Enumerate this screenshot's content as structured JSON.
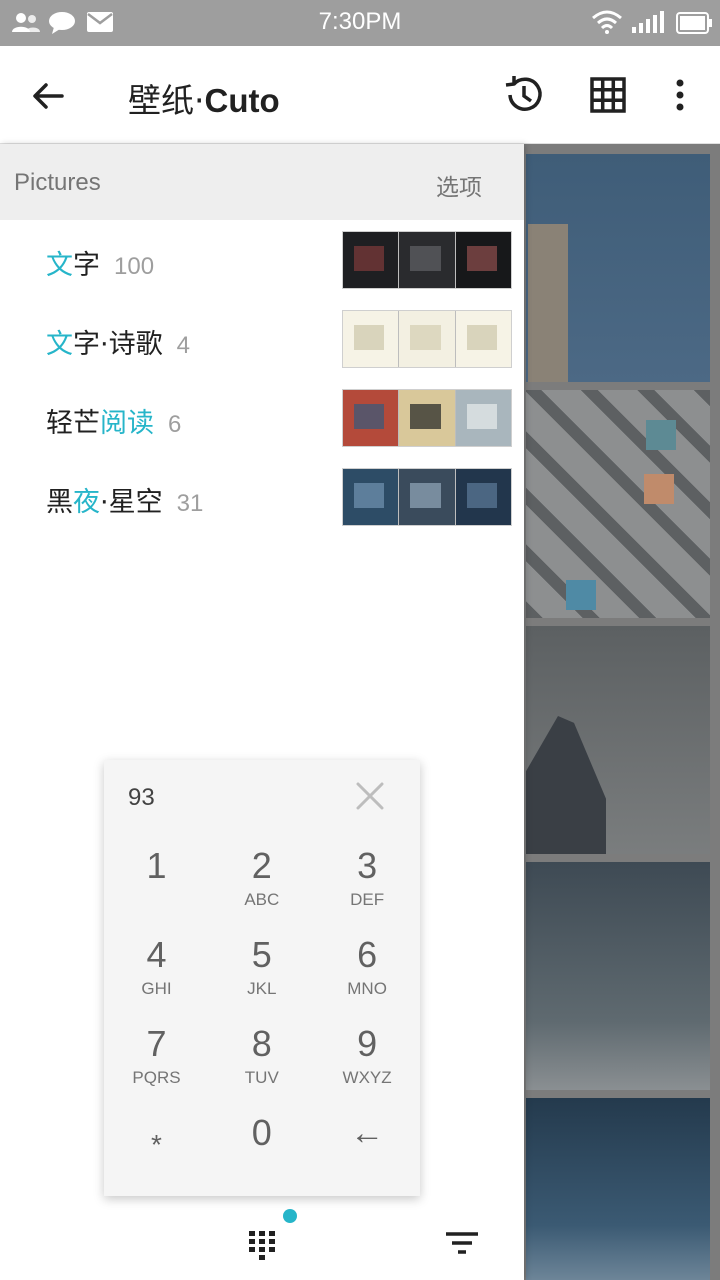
{
  "status_bar": {
    "time": "7:30PM",
    "left_icons": [
      "contacts-icon",
      "chat-icon",
      "mail-icon"
    ],
    "right_icons": [
      "wifi-icon",
      "signal-icon",
      "battery-icon"
    ]
  },
  "app_bar": {
    "title_cn": "壁纸·",
    "title_latin": "Cuto",
    "back_icon": "arrow-left-icon",
    "actions": [
      "history-icon",
      "grid-view-icon",
      "more-vert-icon"
    ]
  },
  "panel": {
    "header_title": "Pictures",
    "header_options": "选项",
    "items": [
      {
        "name_parts": [
          {
            "t": "文",
            "hl": true
          },
          {
            "t": "字",
            "hl": false
          }
        ],
        "count": "100",
        "thumb": "text-collage"
      },
      {
        "name_parts": [
          {
            "t": "文",
            "hl": true
          },
          {
            "t": "字·诗歌",
            "hl": false
          }
        ],
        "count": "4",
        "thumb": "poem-pages"
      },
      {
        "name_parts": [
          {
            "t": "轻芒",
            "hl": false
          },
          {
            "t": "阅读",
            "hl": true
          }
        ],
        "count": "6",
        "thumb": "reading-photos"
      },
      {
        "name_parts": [
          {
            "t": "黑",
            "hl": false
          },
          {
            "t": "夜",
            "hl": true
          },
          {
            "t": "·星空",
            "hl": false
          }
        ],
        "count": "31",
        "thumb": "night-sky"
      }
    ]
  },
  "dialpad": {
    "input_value": "93",
    "keys": [
      {
        "digit": "1",
        "letters": ""
      },
      {
        "digit": "2",
        "letters": "ABC"
      },
      {
        "digit": "3",
        "letters": "DEF"
      },
      {
        "digit": "4",
        "letters": "GHI"
      },
      {
        "digit": "5",
        "letters": "JKL"
      },
      {
        "digit": "6",
        "letters": "MNO"
      },
      {
        "digit": "7",
        "letters": "PQRS"
      },
      {
        "digit": "8",
        "letters": "TUV"
      },
      {
        "digit": "9",
        "letters": "WXYZ"
      },
      {
        "digit": "*",
        "letters": ""
      },
      {
        "digit": "0",
        "letters": ""
      },
      {
        "digit": "←",
        "letters": ""
      }
    ]
  },
  "colors": {
    "accent": "#26b5c9",
    "status_bar": "#9e9e9e",
    "panel_header": "#eeeeee"
  }
}
